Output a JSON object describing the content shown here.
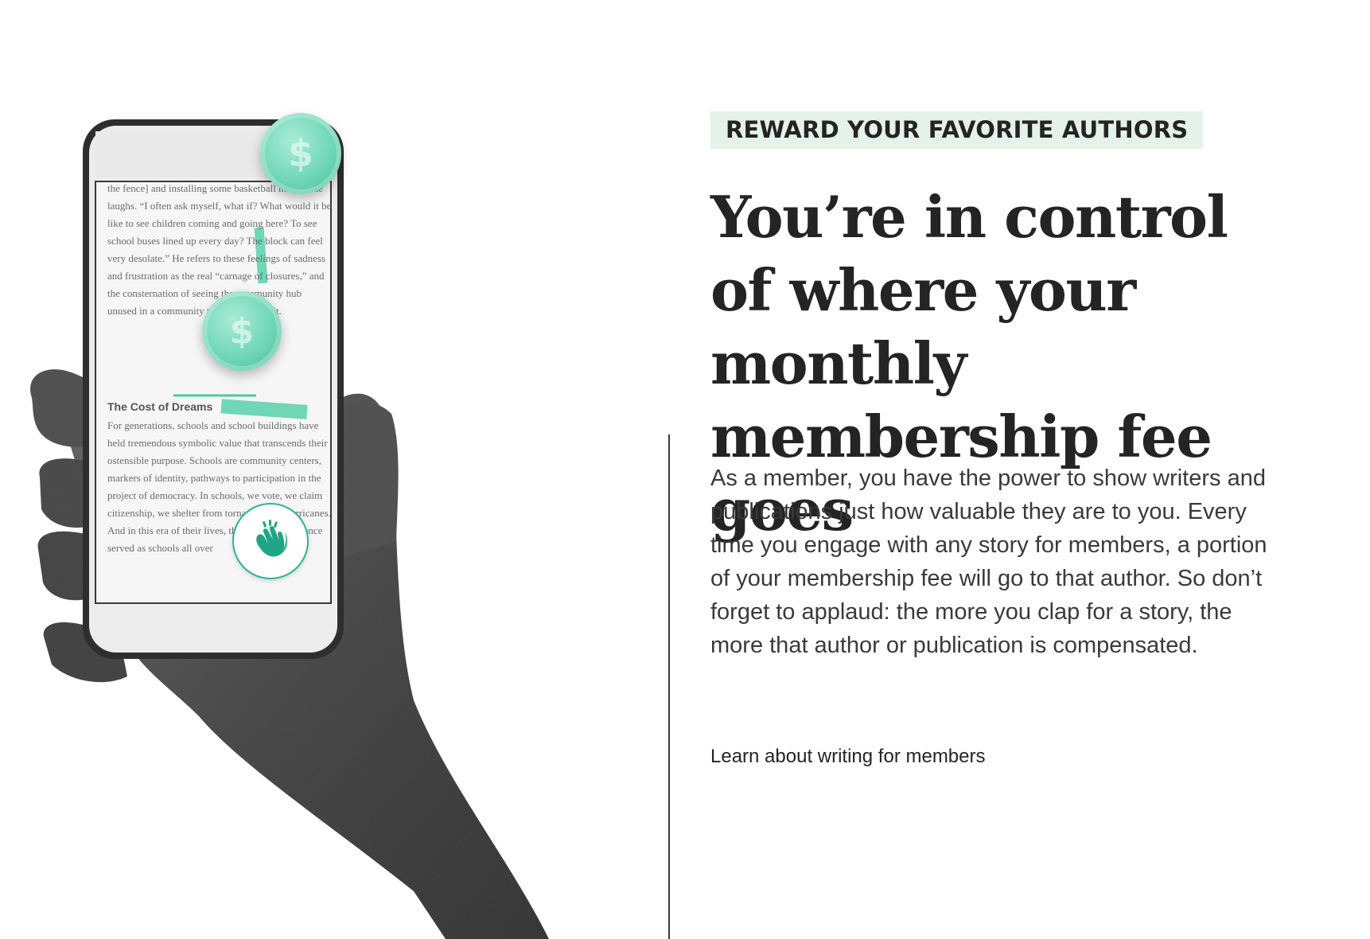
{
  "illustration": {
    "phone_screen": {
      "paragraph_1": "the fence] and installing some basketball hoops,” he laughs. “I often ask myself, what if? What would it be like to see children coming and going here? To see school buses lined up every day? The block can feel very desolate.” He refers to these feelings of sadness and frustration as the real “carnage of closures,” and the consternation of seeing the community hub unused in a community that truly needs it.",
      "section_heading": "The Cost of Dreams",
      "paragraph_2": "For generations, schools and school buildings have held tremendous symbolic value that transcends their ostensible purpose. Schools are community centers, markers of identity, pathways to participation in the project of democracy. In schools, we vote, we claim citizenship, we shelter from tornadoes and hurricanes. And in this era of their lives, the buildings that once served as schools all over"
    },
    "icons": [
      "hand-icon",
      "phone-icon",
      "coin-icon",
      "clap-icon"
    ],
    "accent_color": "#6fd6b6"
  },
  "content": {
    "eyebrow": "REWARD YOUR FAVORITE AUTHORS",
    "headline": "You’re in control of where your monthly membership fee goes",
    "body": "As a member, you have the power to show writers and publications just how valuable they are to you. Every time you engage with any story for members, a portion of your membership fee will go to that author. So don’t forget to applaud: the more you clap for a story, the more that author or publication is compensated.",
    "link_label": "Learn about writing for members"
  },
  "colors": {
    "eyebrow_bg": "#e4f2ea",
    "text": "#242424",
    "rule": "#3a3a3a"
  }
}
